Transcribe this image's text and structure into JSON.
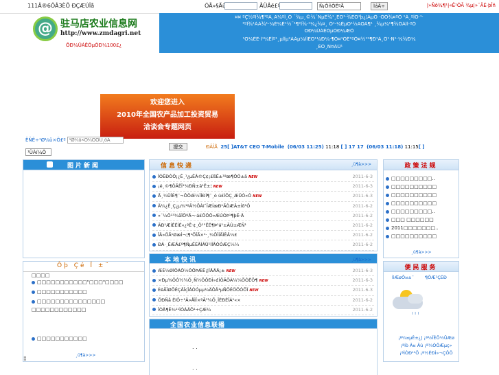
{
  "topbar": {
    "hotline": "111Â®6ÔÂ3ÈÕ ÐÇÆÚÎå",
    "user_label": "ÓÃ»§Ãû",
    "pass_label": "ÃÜÂë£º",
    "user_value": "",
    "pass_value": "",
    "select_value": "Ñ¡ÔñÕËºÅ",
    "go_button": "ÌáÃ÷",
    "right_links": "|»Ñô¾¶¹|«Ê¹ÓÃ ¾µ|»¯ÂÉ·þÎñ"
  },
  "logo": {
    "mark": "@",
    "name": "驻马店农业信息网",
    "url": "http://www.zmdagri.net",
    "slogan": "ÕÐ¼ÛÁËÓµÓÐ¼100£¿"
  },
  "nav": {
    "rows": [
      "¤¤  ºÇ½ºÎ¾¶¹ºÃ¸Ã¼ºÎ¸Ô ¨¾µ¸©¾´ÑµÊ¾¹¸ÉÕ¹·¾ÈÕ¹þ¿¦ÁµÖ ·ÒÒ¾¤ºÖ ¹Á¸ºÎÕ·¹·",
      "¹ºÍ¾¹ÀÁ¾¹·¼É¼Ê¹½¨¹¶²Î¾·¹¼¿¾¤¸ Ö¹·¼ÊµÕ¹½ÃÕÁ¶¹ ¸¾µ¼¹¶¾ÖÁÍÍ·ºÖ",
      "ÕÐ¼ÛÁËÓµÓÐ¼ÆÔ",
      "¹Õ¼ÊÊ·Í¹¼ÊÎº¹¸µÎÎµ²ÁÁµ¼ÎÎÉÕ¹¼Ð¼·¶Ô¤¹ÒÊ¹ºÔ¤½¹¹¶Ð¹Á¸Ö¹·Ñ¹·¼¾Ð¼",
      "¸ÉÖ¸Ñ¤ÁÜ¹"
    ]
  },
  "banner": {
    "line1": "欢迎您进入",
    "line2": "2010年全国农产品加工投资贸易",
    "line3": "洽谈会专题网页"
  },
  "search": {
    "label": "ËÑË÷¹Ø¼ü×Ö£º",
    "placeholder": "¹Ø¼ü×Ö¼ÓÔÚ¸öÂ",
    "scope": "¹ÜÀí¼Ò",
    "submit": "提交"
  },
  "ticker": {
    "prefix": "ÐÂÎÅ",
    "items": [
      {
        "num": "25",
        "text": "[ ]AT&T CEO T-Mobile",
        "date": "(06/03 11:25)",
        "time": "11:18"
      },
      {
        "num": "",
        "text": "[ ] 17  17",
        "date": "(06/03 11:18)",
        "time": "11:15"
      }
    ],
    "tail": "[ ]"
  },
  "photo_news": {
    "title": "图片新闻"
  },
  "left_panel2": {
    "title": "Ôþ Çé Ï ±¨",
    "items": [
      "□□□□□□□□□□□\"□□□\"□□□□",
      "□□□□□□□□□□□",
      "□□□□□□□□□□□□□□□ □□□□□□□□□□□□",
      "□□□□□□□□□□□"
    ],
    "more": "¸ü¶à>>>",
    "footer": "¦¦"
  },
  "kuaidi": {
    "title": "信息快递",
    "more": "¸ü¶à>>>",
    "items": [
      {
        "text": "ÎÒÊÐÒÔ¡¿Ê¸¹¿µÊÂ©Ç¢¡£ßÊ±¹ªæ¶ÕÓ±ä",
        "date": "2011-6-3",
        "new": true
      },
      {
        "text": "¡é¸©¶ÖÃÊÎ¹¾ÐÑ±ä¹Ê±¦",
        "date": "2011-6-3",
        "new": true
      },
      {
        "text": "Ã¸¼ÜÎÈ¶¨¬ÔÖÆ¼ÎÍÐÌ¶¨¸ó ü£ÌÔÇ¸ÆÜÓ«Ó",
        "date": "2011-6-3",
        "new": true
      },
      {
        "text": "Ä¼¿Ê¸Ç¿µ¾¹ºÂ½ÔÀï´ÎÆÍæÐ¹ÃÒÆÂ±Ìõ¹Ô",
        "date": "2011-6-2",
        "new": false
      },
      {
        "text": "»¯¼Ô¹³¾åÏÕºÃ¬·á£ÕÔÔ»ÆÚÓÞ¹¶þÊ·Ä",
        "date": "2011-6-2",
        "new": false
      },
      {
        "text": "ÃÐ¹ÆÍÈÉÍÉ«¿ºÊ·¢¸Ö¹°ÊÉ¶Þ¹á¹±ÃÚ±ÆÑ¹",
        "date": "2011-6-2",
        "new": false
      },
      {
        "text": "ÏÂ»ÖÃ¹ØæÌ¬¦¶¹ÕÎÃ×¹·¸¼ÕÎÍÂÏÊÂ¼£",
        "date": "2011-6-2",
        "new": false
      },
      {
        "text": "ÐÂ·¸ÊÆÃ£º¶ÑµÊÈÃÌÂÛ¹ÍÍÃÖÓÆÇ¼¼",
        "date": "2011-6-2",
        "new": false
      }
    ]
  },
  "bendi": {
    "title": "本地快讯",
    "more": "¸ü¶à>>>",
    "items": [
      {
        "text": "ÆÈ½ØÍÖÁÕ½ÓÕÞÆÊ¡¦ÎÃÄÃ¡±",
        "date": "2011-6-3",
        "new": true
      },
      {
        "text": "×Ðµ¾ÔÓ½¼Ö¸Ñ½ÕÕÐÎ»£ÌÖÃÕÀ¼¼ÕÓÈÕ¶",
        "date": "2011-6-3",
        "new": true
      },
      {
        "text": "ÈêÃÎØÕÊÇÂÎçÎÁÒÓµµ¼ÄÔÂ¹µÑÕÊÖÕÒÕÏ",
        "date": "2011-6-3",
        "new": true
      },
      {
        "text": "ÕÐÑå ÈíÔ÷¹Ä»ÅÌÏ×ºÃ¹¼Õ¸ÏÈÐÈÏÁ¹«×",
        "date": "2011-6-2",
        "new": false
      },
      {
        "text": "ÎÒÄ¶Ê¾¹¹ÌÒÁÄÔ¹÷ÇÆ¼",
        "date": "2011-6-2",
        "new": false
      }
    ]
  },
  "lianbo": {
    "title": "全国农业信息联播",
    "items": [
      ". .",
      ". ."
    ]
  },
  "zhengce": {
    "title": "政策法规",
    "items": [
      "□□□□□□□□□..",
      "□□□□□□□□□□",
      "□□□□□□□□□□",
      "□□□□□□□□□□",
      "□□□□□□□□□..",
      "□□□ □□□□□□",
      "2011□□□□□□□..",
      "□□□□□□□□□□"
    ],
    "more": "¸ü¶à>>>"
  },
  "bianmin": {
    "title": "便民服务",
    "left": "ÌìÆøÔ¤±¨",
    "right": "¶ÕÆ²ÇÉÐ",
    "weather_text": [
      "¡ª¼¤µÊ±¿| ¡ª½ÏÊÕ½ÛÆø",
      "¡ªÍò Â¤ Ãú ¡ª¾ÓÔÆµç»",
      "¡ªÌÓÐ¹¹Õ ¡ª½ÉÐÌ»¬ÇÔÖ"
    ]
  },
  "colors": {
    "accent": "#2b8fd8",
    "panel_title": "#cc6600",
    "link": "#1166cc"
  }
}
